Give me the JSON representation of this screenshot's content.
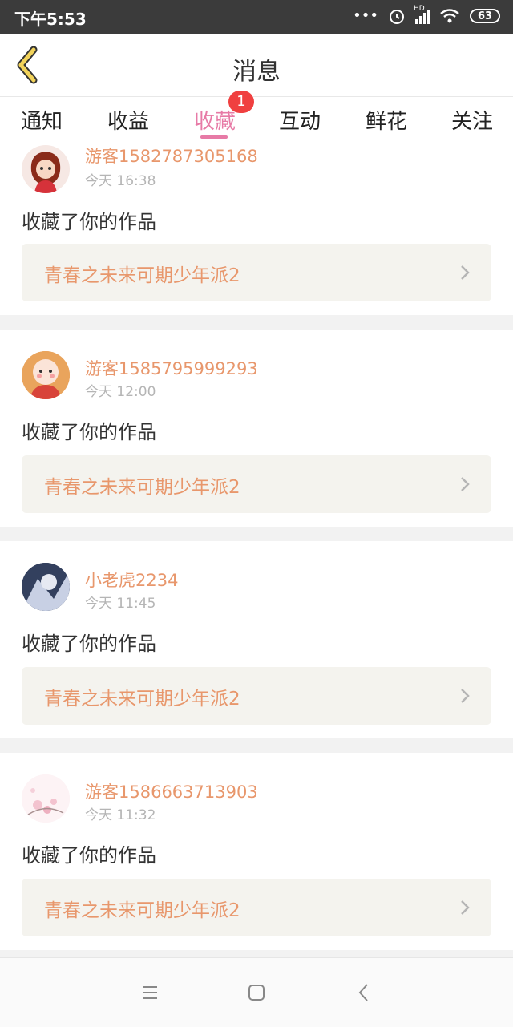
{
  "status": {
    "time": "下午5:53",
    "battery": "63",
    "signal_label": "HD"
  },
  "header": {
    "title": "消息",
    "back_icon": "back-chevron-icon"
  },
  "tabs": [
    {
      "label": "通知"
    },
    {
      "label": "收益"
    },
    {
      "label": "收藏",
      "active": true,
      "badge": "1"
    },
    {
      "label": "互动"
    },
    {
      "label": "鲜花"
    },
    {
      "label": "关注"
    }
  ],
  "items": [
    {
      "user": "游客1582787305168",
      "time": "今天 16:38",
      "action": "收藏了你的作品",
      "work": "青春之未来可期少年派2"
    },
    {
      "user": "游客1585795999293",
      "time": "今天 12:00",
      "action": "收藏了你的作品",
      "work": "青春之未来可期少年派2"
    },
    {
      "user": "小老虎2234",
      "time": "今天 11:45",
      "action": "收藏了你的作品",
      "work": "青春之未来可期少年派2"
    },
    {
      "user": "游客1586663713903",
      "time": "今天 11:32",
      "action": "收藏了你的作品",
      "work": "青春之未来可期少年派2"
    }
  ],
  "colors": {
    "accent": "#e77aa6",
    "username": "#e8976c",
    "badge": "#f04040",
    "card_bg": "#f4f3ee"
  }
}
